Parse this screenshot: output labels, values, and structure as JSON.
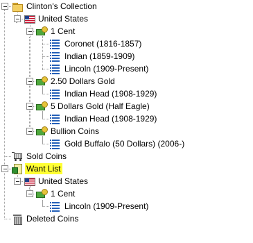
{
  "tree": {
    "collection": "Clinton's Collection",
    "united_states": "United States",
    "one_cent": "1 Cent",
    "coronet": "Coronet (1816-1857)",
    "indian": "Indian (1859-1909)",
    "lincoln": "Lincoln (1909-Present)",
    "gold_250": "2.50 Dollars Gold",
    "indian_head_1": "Indian Head (1908-1929)",
    "gold_5": "5 Dollars Gold (Half Eagle)",
    "indian_head_2": "Indian Head (1908-1929)",
    "bullion": "Bullion Coins",
    "gold_buffalo": "Gold Buffalo (50 Dollars) (2006-)",
    "sold_coins": "Sold Coins",
    "want_list": "Want List",
    "want_united_states": "United States",
    "want_one_cent": "1 Cent",
    "want_lincoln": "Lincoln (1909-Present)",
    "deleted_coins": "Deleted Coins"
  },
  "colors": {
    "selection_highlight": "#ffff33",
    "tree_line": "#a0a0a0"
  },
  "icons": {
    "collection": "folder-icon",
    "country": "flag-icon",
    "denomination": "money-icon",
    "series": "list-icon",
    "sold": "cart-icon",
    "want": "want-list-icon",
    "deleted": "trash-icon"
  }
}
